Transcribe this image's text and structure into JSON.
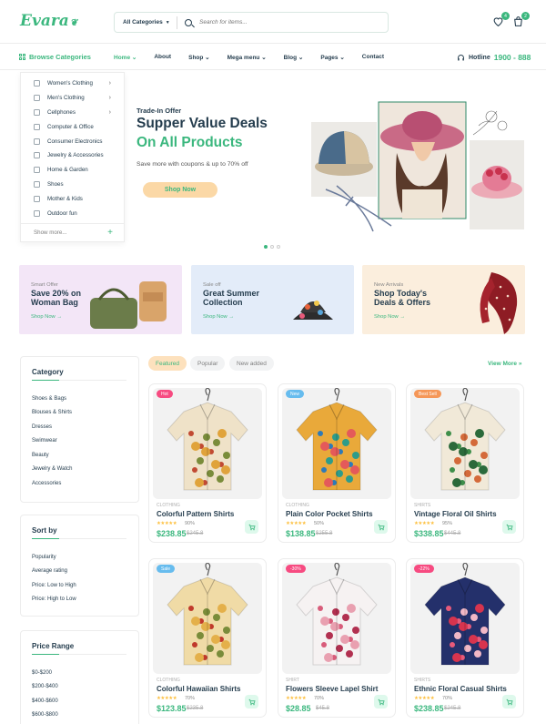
{
  "header": {
    "logo_text": "Evara",
    "search": {
      "category": "All Categories",
      "placeholder": "Search for items..."
    },
    "wishlist_count": "4",
    "cart_count": "2"
  },
  "nav": {
    "browse_label": "Browse Categories",
    "items": [
      "Home",
      "About",
      "Shop",
      "Mega menu",
      "Blog",
      "Pages",
      "Contact"
    ],
    "hotline_label": "Hotline",
    "hotline_number": "1900 - 888"
  },
  "categories": {
    "items": [
      "Women's Clothing",
      "Men's Clothing",
      "Cellphones",
      "Computer & Office",
      "Consumer Electronics",
      "Jewelry & Accessories",
      "Home & Garden",
      "Shoes",
      "Mother & Kids",
      "Outdoor fun"
    ],
    "show_more": "Show more..."
  },
  "hero": {
    "pretitle": "Trade-In Offer",
    "title_line1": "Supper Value Deals",
    "title_line2": "On All Products",
    "subtitle": "Save more with coupons & up to 70% off",
    "button": "Shop Now"
  },
  "banners": [
    {
      "sub": "Smart Offer",
      "title": "Save 20% on Woman Bag",
      "link": "Shop Now →"
    },
    {
      "sub": "Sale off",
      "title": "Great Summer Collection",
      "link": "Shop Now →"
    },
    {
      "sub": "New Arrivals",
      "title": "Shop Today's Deals & Offers",
      "link": "Shop Now →"
    }
  ],
  "sidebar": {
    "category_title": "Category",
    "category_items": [
      "Shoes & Bags",
      "Blouses & Shirts",
      "Dresses",
      "Swimwear",
      "Beauty",
      "Jewelry & Watch",
      "Accessories"
    ],
    "sort_title": "Sort by",
    "sort_items": [
      "Popularity",
      "Average rating",
      "Price: Low to High",
      "Price: High to Low"
    ],
    "price_title": "Price Range",
    "price_items": [
      "$0-$200",
      "$200-$400",
      "$400-$600",
      "$600-$800"
    ]
  },
  "tabs": {
    "items": [
      "Featured",
      "Popular",
      "New added"
    ],
    "view_more": "View More »"
  },
  "products": [
    {
      "tag": "Hot",
      "tag_color": "#f74b81",
      "category": "CLOTHING",
      "name": "Colorful Pattern Shirts",
      "rating": "90%",
      "stars": 5,
      "price": "$238.85",
      "old_price": "$245.8"
    },
    {
      "tag": "New",
      "tag_color": "#67bcee",
      "category": "CLOTHING",
      "name": "Plain Color Pocket Shirts",
      "rating": "50%",
      "stars": 5,
      "price": "$138.85",
      "old_price": "$255.8"
    },
    {
      "tag": "Best Sell",
      "tag_color": "#f59758",
      "category": "SHIRTS",
      "name": "Vintage Floral Oil Shirts",
      "rating": "95%",
      "stars": 5,
      "price": "$338.85",
      "old_price": "$445.8"
    },
    {
      "tag": "Sale",
      "tag_color": "#67bcee",
      "category": "CLOTHING",
      "name": "Colorful Hawaiian Shirts",
      "rating": "70%",
      "stars": 5,
      "price": "$123.85",
      "old_price": "$235.8"
    },
    {
      "tag": "-30%",
      "tag_color": "#f74b81",
      "category": "SHIRT",
      "name": "Flowers Sleeve Lapel Shirt",
      "rating": "70%",
      "stars": 5,
      "price": "$28.85",
      "old_price": "$45.8"
    },
    {
      "tag": "-22%",
      "tag_color": "#f74b81",
      "category": "SHIRTS",
      "name": "Ethnic Floral Casual Shirts",
      "rating": "70%",
      "stars": 5,
      "price": "$238.85",
      "old_price": "$245.8"
    }
  ],
  "colors": {
    "brand": "#3bb77e",
    "heading": "#253d4e",
    "accent_light": "#fde1bd"
  }
}
